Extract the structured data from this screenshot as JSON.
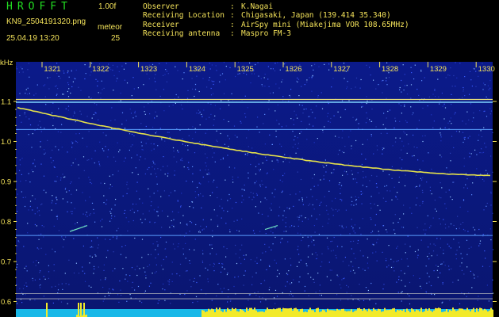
{
  "app": {
    "title": "HROFFT",
    "version": "1.00f",
    "filename": "KN9_2504191320.png",
    "unit_label": "meteor",
    "timestamp": "25.04.19 13:20",
    "count": "25"
  },
  "metadata": [
    {
      "label": "Observer",
      "value": "K.Nagai"
    },
    {
      "label": "Receiving Location",
      "value": "Chigasaki, Japan (139.414 35.340)"
    },
    {
      "label": "Receiver",
      "value": "AirSpy mini (Miakejima VOR 108.65MHz)"
    },
    {
      "label": "Receiving antenna",
      "value": "Maspro FM-3"
    }
  ],
  "axis": {
    "y_unit": "kHz",
    "y_ticks": [
      "1.1",
      "1.0",
      "0.9",
      "0.8",
      "0.7",
      "0.6"
    ],
    "x_ticks": [
      "1321",
      "1322",
      "1323",
      "1324",
      "1325",
      "1326",
      "1327",
      "1328",
      "1329",
      "1330"
    ]
  },
  "colors": {
    "background": "#000000",
    "noise_blue": "#1a2fb0",
    "text_yellow": "#f3e25a",
    "title_green": "#22dd22",
    "trace_yellow": "#e6e24a",
    "level_cyan": "#2bd8f0"
  }
}
